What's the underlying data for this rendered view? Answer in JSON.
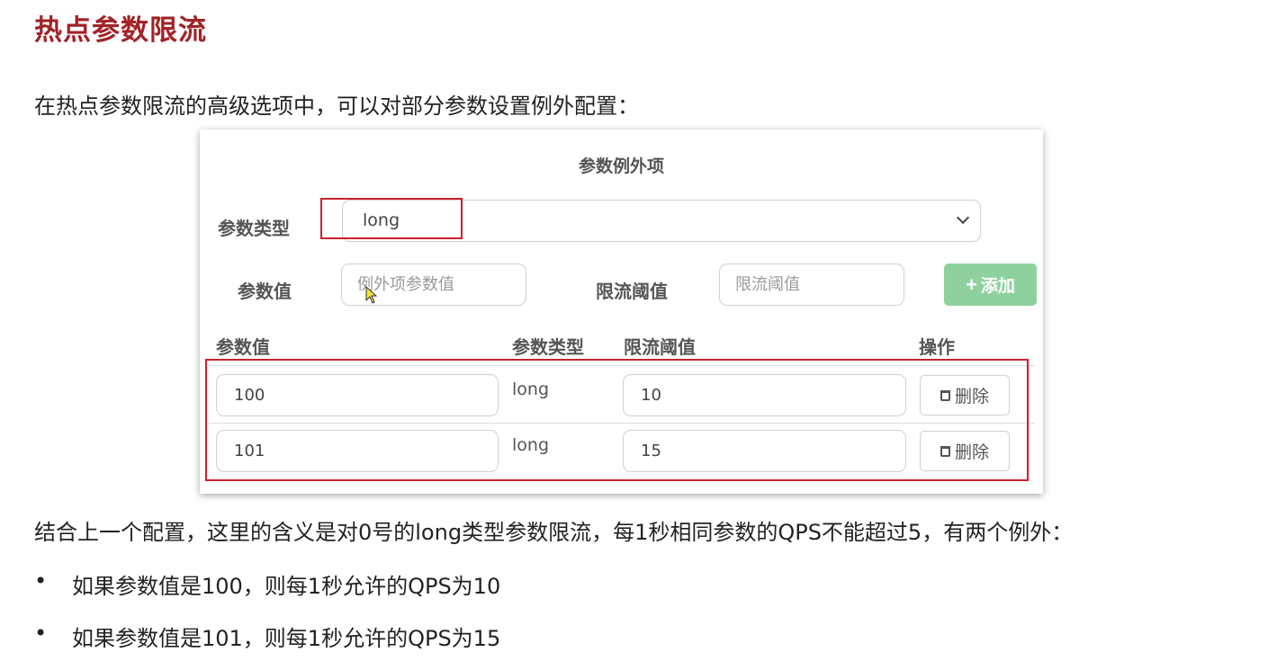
{
  "slide": {
    "title": "热点参数限流",
    "intro": "在热点参数限流的高级选项中，可以对部分参数设置例外配置："
  },
  "panel": {
    "title": "参数例外项",
    "param_type_label": "参数类型",
    "param_type_value": "long",
    "param_value_label": "参数值",
    "param_value_placeholder": "例外项参数值",
    "threshold_label": "限流阈值",
    "threshold_placeholder": "限流阈值",
    "add_button_label": "添加",
    "columns": [
      "参数值",
      "参数类型",
      "限流阈值",
      "操作"
    ],
    "rows": [
      {
        "value": "100",
        "type": "long",
        "threshold": "10",
        "action_label": "删除"
      },
      {
        "value": "101",
        "type": "long",
        "threshold": "15",
        "action_label": "删除"
      }
    ]
  },
  "summary": "结合上一个配置，这里的含义是对0号的long类型参数限流，每1秒相同参数的QPS不能超过5，有两个例外：",
  "bullets": [
    "如果参数值是100，则每1秒允许的QPS为10",
    "如果参数值是101，则每1秒允许的QPS为15"
  ],
  "bullet_symbol": "•",
  "colors": {
    "title": "#a12227",
    "highlight_border": "#c8222e",
    "add_button": "#8fd19e"
  },
  "icons": {
    "add": "plus-icon",
    "delete": "trash-icon",
    "select": "chevron-down-icon",
    "cursor": "mouse-cursor-icon"
  }
}
